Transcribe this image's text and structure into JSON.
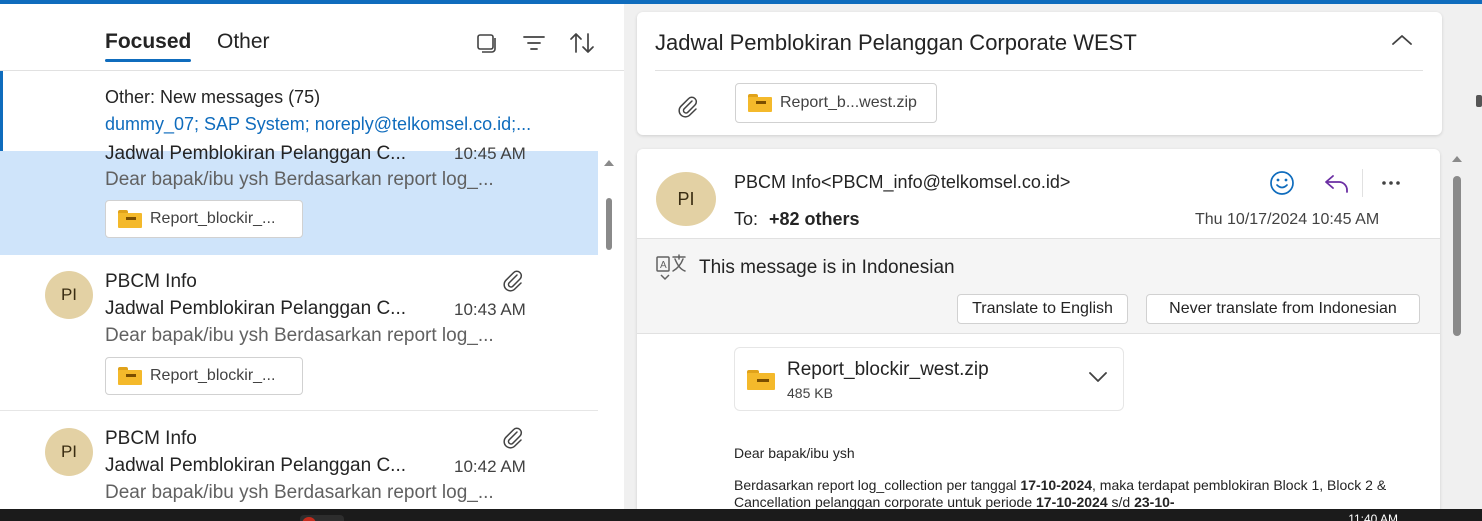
{
  "tabs": {
    "focused": "Focused",
    "other": "Other"
  },
  "notice": {
    "title": "Other: New messages (75)",
    "senders": "dummy_07; SAP System; noreply@telkomsel.co.id;..."
  },
  "messages": [
    {
      "subject": "Jadwal Pemblokiran Pelanggan C...",
      "time": "10:45 AM",
      "preview": "Dear bapak/ibu ysh Berdasarkan report log_...",
      "attachment": "Report_blockir_..."
    },
    {
      "avatar": "PI",
      "sender": "PBCM Info",
      "subject": "Jadwal Pemblokiran Pelanggan C...",
      "time": "10:43 AM",
      "preview": "Dear bapak/ibu ysh Berdasarkan report log_...",
      "attachment": "Report_blockir_..."
    },
    {
      "avatar": "PI",
      "sender": "PBCM Info",
      "subject": "Jadwal Pemblokiran Pelanggan C...",
      "time": "10:42 AM",
      "preview": "Dear bapak/ibu ysh Berdasarkan report log_..."
    }
  ],
  "reading": {
    "subject": "Jadwal Pemblokiran Pelanggan Corporate WEST",
    "header_attachment": "Report_b...west.zip",
    "avatar": "PI",
    "from": "PBCM Info<PBCM_info@telkomsel.co.id>",
    "to_label": "To:",
    "to_value": "+82 others",
    "date": "Thu 10/17/2024 10:45 AM",
    "translate_message": "This message is in Indonesian",
    "translate_button": "Translate to English",
    "never_translate_button": "Never translate from Indonesian",
    "attachment_name": "Report_blockir_west.zip",
    "attachment_size": "485 KB",
    "greeting": "Dear bapak/ibu ysh",
    "para_1": "Berdasarkan report log_collection per tanggal ",
    "para_date1": "17-10-2024",
    "para_2": ", maka terdapat pemblokiran Block 1, Block 2 & Cancellation pelanggan corporate untuk periode ",
    "para_date2": "17-10-2024",
    "para_3": " s/d ",
    "para_date3": "23-10-"
  },
  "taskbar": {
    "time": "11:40 AM"
  },
  "colors": {
    "accent": "#0f6cbd",
    "selected": "#cfe4fa",
    "avatar": "#e3d1a4",
    "reply": "#6b2fa3"
  },
  "icons": [
    "layout-icon",
    "filter-icon",
    "sort-icon",
    "paperclip-icon",
    "chevron-up-icon",
    "emoji-icon",
    "reply-icon",
    "more-icon",
    "translate-icon",
    "chevron-down-icon",
    "zip-file-icon"
  ]
}
